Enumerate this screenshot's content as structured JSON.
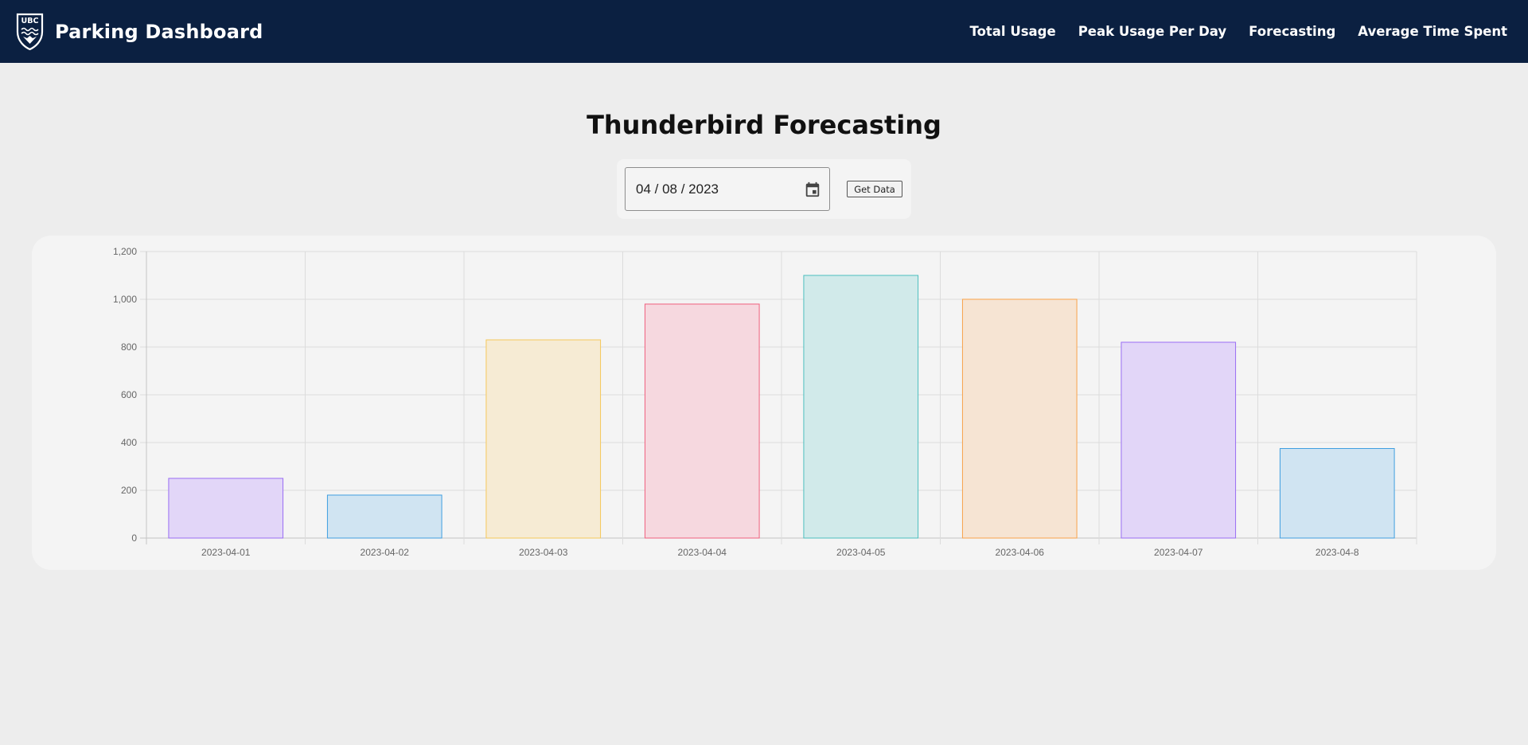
{
  "navbar": {
    "logo_text": "UBC",
    "brand_title": "Parking Dashboard",
    "links": [
      "Total Usage",
      "Peak Usage Per Day",
      "Forecasting",
      "Average Time Spent"
    ],
    "background_color": "#0b2041"
  },
  "page": {
    "title": "Thunderbird Forecasting"
  },
  "controls": {
    "date_value": "04 / 08 / 2023",
    "calendar_icon": "calendar-icon",
    "get_data_label": "Get Data"
  },
  "chart_data": {
    "type": "bar",
    "categories": [
      "2023-04-01",
      "2023-04-02",
      "2023-04-03",
      "2023-04-04",
      "2023-04-05",
      "2023-04-06",
      "2023-04-07",
      "2023-04-8"
    ],
    "values": [
      250,
      180,
      830,
      980,
      1100,
      1000,
      820,
      375
    ],
    "ylim": [
      0,
      1200
    ],
    "yticks": [
      0,
      200,
      400,
      600,
      800,
      1000,
      1200
    ],
    "ytick_labels": [
      "0",
      "200",
      "400",
      "600",
      "800",
      "1,000",
      "1,200"
    ],
    "grid": true,
    "title": "",
    "xlabel": "",
    "ylabel": "",
    "bar_colors": [
      {
        "fill": "#e2d6f8",
        "stroke": "#9a6df3"
      },
      {
        "fill": "#d0e4f2",
        "stroke": "#3f9ee0"
      },
      {
        "fill": "#f6ebd4",
        "stroke": "#f5c85a"
      },
      {
        "fill": "#f6d8df",
        "stroke": "#f0607e"
      },
      {
        "fill": "#d1eaea",
        "stroke": "#4cbfbf"
      },
      {
        "fill": "#f6e4d3",
        "stroke": "#f9a24a"
      },
      {
        "fill": "#e2d6f8",
        "stroke": "#9a6df3"
      },
      {
        "fill": "#d0e4f2",
        "stroke": "#3f9ee0"
      }
    ]
  }
}
